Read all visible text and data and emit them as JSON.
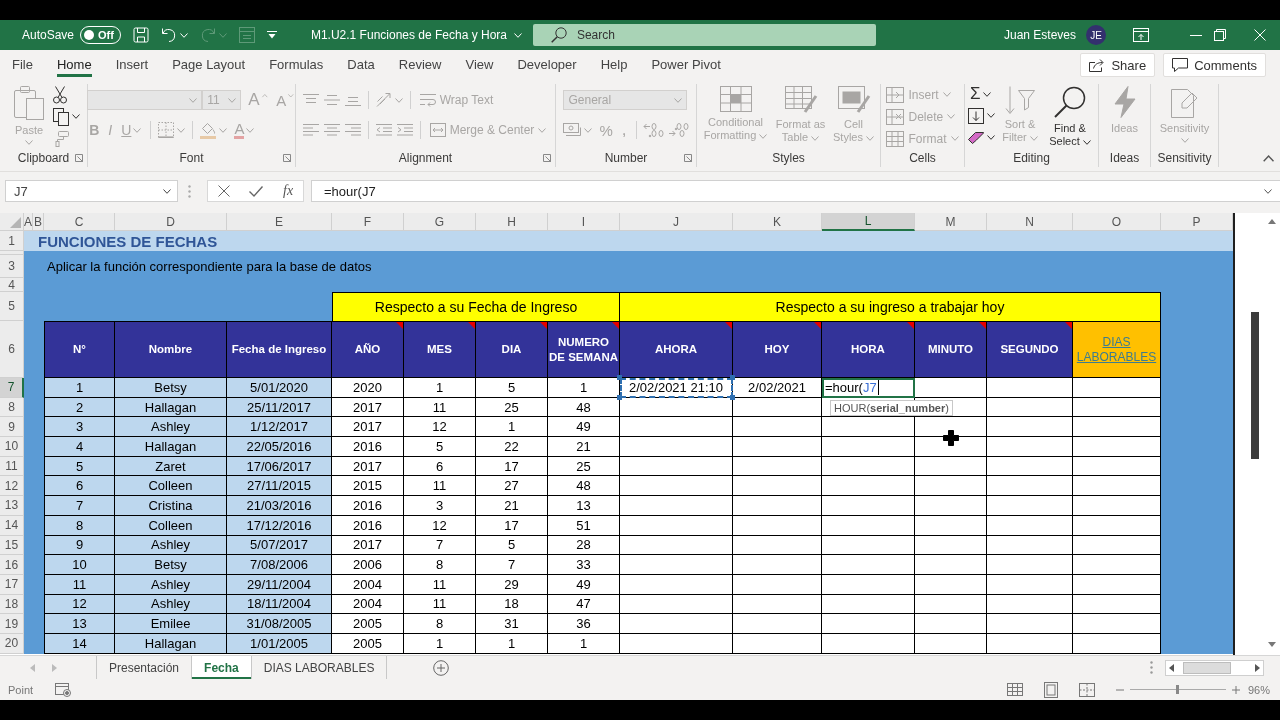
{
  "title_bar": {
    "autosave": {
      "label": "AutoSave",
      "on": false,
      "state_text": "Off"
    },
    "quick_access": [
      {
        "kind": "save",
        "menu": false,
        "disabled": false
      },
      {
        "kind": "undo",
        "menu": true,
        "disabled": false
      },
      {
        "kind": "redo",
        "menu": true,
        "disabled": true
      },
      {
        "kind": "form",
        "menu": false,
        "disabled": true
      },
      {
        "kind": "customize",
        "menu": false,
        "disabled": false
      }
    ],
    "document_title": "M1.U2.1 Funciones de Fecha y Hora",
    "search": {
      "placeholder": "Search"
    },
    "user": {
      "name": "Juan Esteves",
      "initials": "JE"
    }
  },
  "ribbon_tabs": [
    {
      "label": "File",
      "selected": false
    },
    {
      "label": "Home",
      "selected": true
    },
    {
      "label": "Insert",
      "selected": false
    },
    {
      "label": "Page Layout",
      "selected": false
    },
    {
      "label": "Formulas",
      "selected": false
    },
    {
      "label": "Data",
      "selected": false
    },
    {
      "label": "Review",
      "selected": false
    },
    {
      "label": "View",
      "selected": false
    },
    {
      "label": "Developer",
      "selected": false
    },
    {
      "label": "Help",
      "selected": false
    },
    {
      "label": "Power Pivot",
      "selected": false
    }
  ],
  "ribbon_actions": [
    {
      "kind": "share",
      "label": "Share"
    },
    {
      "kind": "comments",
      "label": "Comments"
    }
  ],
  "ribbon": {
    "groups": [
      {
        "label": "Clipboard",
        "launcher": true,
        "sections": [
          {
            "kind": "big",
            "button": {
              "kind": "paste",
              "label": "Paste",
              "menu": true,
              "disabled": true
            }
          },
          {
            "kind": "stack",
            "items": [
              {
                "kind": "cut",
                "menu": false,
                "disabled": false
              },
              {
                "kind": "copy",
                "menu": true,
                "disabled": false
              },
              {
                "kind": "format-painter",
                "menu": false,
                "disabled": true
              }
            ]
          }
        ]
      },
      {
        "label": "Font",
        "launcher": true,
        "sections": [
          {
            "kind": "rows",
            "rows": [
              [
                {
                  "kind": "font-name",
                  "menu": true,
                  "disabled": true
                },
                {
                  "kind": "font-size",
                  "value": "11",
                  "menu": true,
                  "disabled": true
                },
                {
                  "kind": "grow-font",
                  "glyph": "A",
                  "menu": false,
                  "disabled": true
                },
                {
                  "kind": "shrink-font",
                  "glyph": "A",
                  "menu": false,
                  "disabled": true
                }
              ],
              [
                {
                  "kind": "bold",
                  "glyph": "B",
                  "menu": false,
                  "disabled": true
                },
                {
                  "kind": "italic",
                  "glyph": "I",
                  "menu": false,
                  "disabled": true
                },
                {
                  "kind": "underline",
                  "glyph": "U",
                  "menu": true,
                  "disabled": true
                },
                {
                  "kind": "separator"
                },
                {
                  "kind": "borders",
                  "menu": true,
                  "disabled": true
                },
                {
                  "kind": "separator"
                },
                {
                  "kind": "fill-color",
                  "menu": true,
                  "disabled": true
                },
                {
                  "kind": "font-color",
                  "glyph": "A",
                  "menu": true,
                  "disabled": true
                }
              ]
            ]
          }
        ]
      },
      {
        "label": "Alignment",
        "launcher": true,
        "sections": [
          {
            "kind": "rows",
            "rows": [
              [
                {
                  "kind": "align-top",
                  "menu": false,
                  "disabled": true
                },
                {
                  "kind": "align-middle",
                  "menu": false,
                  "disabled": true
                },
                {
                  "kind": "align-bottom",
                  "menu": false,
                  "disabled": true
                },
                {
                  "kind": "separator"
                },
                {
                  "kind": "orientation",
                  "menu": true,
                  "disabled": true
                },
                {
                  "kind": "separator"
                },
                {
                  "kind": "wrap-text",
                  "label": "Wrap Text",
                  "menu": false,
                  "disabled": true
                }
              ],
              [
                {
                  "kind": "align-left",
                  "menu": false,
                  "disabled": true
                },
                {
                  "kind": "align-center",
                  "menu": false,
                  "disabled": true
                },
                {
                  "kind": "align-right",
                  "menu": false,
                  "disabled": true
                },
                {
                  "kind": "separator"
                },
                {
                  "kind": "decrease-indent",
                  "menu": false,
                  "disabled": true
                },
                {
                  "kind": "increase-indent",
                  "menu": false,
                  "disabled": true
                },
                {
                  "kind": "separator"
                },
                {
                  "kind": "merge",
                  "label": "Merge & Center",
                  "menu": true,
                  "disabled": true
                }
              ]
            ]
          }
        ]
      },
      {
        "label": "Number",
        "launcher": true,
        "sections": [
          {
            "kind": "rows",
            "rows": [
              [
                {
                  "kind": "number-format",
                  "value": "General",
                  "menu": true,
                  "disabled": true
                }
              ],
              [
                {
                  "kind": "accounting",
                  "menu": true,
                  "disabled": true
                },
                {
                  "kind": "percent",
                  "glyph": "%",
                  "menu": false,
                  "disabled": true
                },
                {
                  "kind": "comma",
                  "glyph": ",",
                  "menu": false,
                  "disabled": true
                },
                {
                  "kind": "separator"
                },
                {
                  "kind": "increase-decimal",
                  "menu": false,
                  "disabled": true
                },
                {
                  "kind": "decrease-decimal",
                  "menu": false,
                  "disabled": true
                }
              ]
            ]
          }
        ]
      },
      {
        "label": "Styles",
        "launcher": false,
        "sections": [
          {
            "kind": "big",
            "button": {
              "kind": "conditional-formatting",
              "label": "Conditional Formatting",
              "menu": true,
              "disabled": true
            }
          },
          {
            "kind": "big",
            "button": {
              "kind": "format-as-table",
              "label": "Format as Table",
              "menu": true,
              "disabled": true
            }
          },
          {
            "kind": "big",
            "button": {
              "kind": "cell-styles",
              "label": "Cell Styles",
              "menu": true,
              "disabled": true
            }
          }
        ]
      },
      {
        "label": "Cells",
        "launcher": false,
        "sections": [
          {
            "kind": "stack",
            "items": [
              {
                "kind": "insert",
                "label": "Insert",
                "menu": true,
                "disabled": true
              },
              {
                "kind": "delete",
                "label": "Delete",
                "menu": true,
                "disabled": true
              },
              {
                "kind": "format",
                "label": "Format",
                "menu": true,
                "disabled": true
              }
            ]
          }
        ]
      },
      {
        "label": "Editing",
        "launcher": false,
        "sections": [
          {
            "kind": "stack",
            "items": [
              {
                "kind": "autosum",
                "glyph": "Σ",
                "menu": true,
                "disabled": false
              },
              {
                "kind": "fill",
                "menu": true,
                "disabled": false
              },
              {
                "kind": "clear",
                "menu": true,
                "disabled": false
              }
            ]
          },
          {
            "kind": "big",
            "button": {
              "kind": "sort-filter",
              "label": "Sort & Filter",
              "menu": true,
              "disabled": true
            }
          },
          {
            "kind": "big",
            "button": {
              "kind": "find-select",
              "label": "Find & Select",
              "menu": true,
              "disabled": false
            }
          }
        ]
      },
      {
        "label": "Ideas",
        "launcher": false,
        "sections": [
          {
            "kind": "big",
            "button": {
              "kind": "ideas",
              "label": "Ideas",
              "menu": false,
              "disabled": true
            }
          }
        ]
      },
      {
        "label": "Sensitivity",
        "launcher": false,
        "sections": [
          {
            "kind": "big",
            "button": {
              "kind": "sensitivity",
              "label": "Sensitivity",
              "menu": true,
              "disabled": true
            }
          }
        ]
      }
    ]
  },
  "formula_bar": {
    "name_box": "J7",
    "function_glyph": "fx",
    "formula": "=hour(J7"
  },
  "sheet": {
    "column_headers": [
      {
        "label": "A",
        "selected": false
      },
      {
        "label": "B",
        "selected": false
      },
      {
        "label": "C",
        "selected": false
      },
      {
        "label": "D",
        "selected": false
      },
      {
        "label": "E",
        "selected": false
      },
      {
        "label": "F",
        "selected": false
      },
      {
        "label": "G",
        "selected": false
      },
      {
        "label": "H",
        "selected": false
      },
      {
        "label": "I",
        "selected": false
      },
      {
        "label": "J",
        "selected": false
      },
      {
        "label": "K",
        "selected": false
      },
      {
        "label": "L",
        "selected": true
      },
      {
        "label": "M",
        "selected": false
      },
      {
        "label": "N",
        "selected": false
      },
      {
        "label": "O",
        "selected": false
      },
      {
        "label": "P",
        "selected": false
      }
    ],
    "row_headers": [
      {
        "label": "1",
        "selected": false
      },
      {
        "selected": false
      },
      {
        "label": "3",
        "selected": false
      },
      {
        "label": "4",
        "selected": false
      },
      {
        "label": "5",
        "selected": false
      },
      {
        "label": "6",
        "selected": false
      }
    ],
    "title": "FUNCIONES DE FECHAS",
    "instruction": "Aplicar la función correspondiente para la base de datos",
    "table": {
      "column_groups": [
        {
          "columns": [
            {
              "label": "N°",
              "kind": "header",
              "shaded": true,
              "comment": false
            },
            {
              "label": "Nombre",
              "kind": "header",
              "shaded": true,
              "comment": false
            },
            {
              "label": "Fecha de Ingreso",
              "kind": "header",
              "shaded": true,
              "comment": false
            }
          ]
        },
        {
          "label": "Respecto a su Fecha de Ingreso",
          "columns": [
            {
              "label": "AÑO",
              "kind": "header",
              "shaded": false,
              "comment": true
            },
            {
              "label": "MES",
              "kind": "header",
              "shaded": false,
              "comment": true
            },
            {
              "label": "DIA",
              "kind": "header",
              "shaded": false,
              "comment": true
            },
            {
              "label": "NUMERO DE SEMANA",
              "kind": "header",
              "shaded": false,
              "comment": true
            }
          ]
        },
        {
          "label": "Respecto a su ingreso a trabajar hoy",
          "columns": [
            {
              "label": "AHORA",
              "kind": "header",
              "shaded": false,
              "comment": true
            },
            {
              "label": "HOY",
              "kind": "header",
              "shaded": false,
              "comment": true
            },
            {
              "label": "HORA",
              "kind": "header",
              "shaded": false,
              "comment": true
            },
            {
              "label": "MINUTO",
              "kind": "header",
              "shaded": false,
              "comment": true
            },
            {
              "label": "SEGUNDO",
              "kind": "header",
              "shaded": false,
              "comment": true
            },
            {
              "label": "DIAS LABORABLES",
              "kind": "link",
              "shaded": false,
              "comment": false
            }
          ]
        }
      ],
      "rows": [
        {
          "header": {
            "label": "7",
            "selected": true
          },
          "cells": [
            "1",
            "Betsy",
            "5/01/2020",
            "2020",
            "1",
            "5",
            "1",
            {
              "kind": "referenced",
              "value": "2/02/2021 21:10"
            },
            "2/02/2021",
            {
              "kind": "editing",
              "value": "=hour(",
              "reference": "J7",
              "tooltip": "HOUR(**serial_number**)"
            }
          ]
        },
        {
          "header": {
            "label": "8",
            "selected": false
          },
          "cells": [
            "2",
            "Hallagan",
            "25/11/2017",
            "2017",
            "11",
            "25",
            "48"
          ]
        },
        {
          "header": {
            "label": "9",
            "selected": false
          },
          "cells": [
            "3",
            "Ashley",
            "1/12/2017",
            "2017",
            "12",
            "1",
            "49"
          ]
        },
        {
          "header": {
            "label": "10",
            "selected": false
          },
          "cells": [
            "4",
            "Hallagan",
            "22/05/2016",
            "2016",
            "5",
            "22",
            "21"
          ]
        },
        {
          "header": {
            "label": "11",
            "selected": false
          },
          "cells": [
            "5",
            "Zaret",
            "17/06/2017",
            "2017",
            "6",
            "17",
            "25"
          ]
        },
        {
          "header": {
            "label": "12",
            "selected": false
          },
          "cells": [
            "6",
            "Colleen",
            "27/11/2015",
            "2015",
            "11",
            "27",
            "48"
          ]
        },
        {
          "header": {
            "label": "13",
            "selected": false
          },
          "cells": [
            "7",
            "Cristina",
            "21/03/2016",
            "2016",
            "3",
            "21",
            "13"
          ]
        },
        {
          "header": {
            "label": "14",
            "selected": false
          },
          "cells": [
            "8",
            "Colleen",
            "17/12/2016",
            "2016",
            "12",
            "17",
            "51"
          ]
        },
        {
          "header": {
            "label": "15",
            "selected": false
          },
          "cells": [
            "9",
            "Ashley",
            "5/07/2017",
            "2017",
            "7",
            "5",
            "28"
          ]
        },
        {
          "header": {
            "label": "16",
            "selected": false
          },
          "cells": [
            "10",
            "Betsy",
            "7/08/2006",
            "2006",
            "8",
            "7",
            "33"
          ]
        },
        {
          "header": {
            "label": "17",
            "selected": false
          },
          "cells": [
            "11",
            "Ashley",
            "29/11/2004",
            "2004",
            "11",
            "29",
            "49"
          ]
        },
        {
          "header": {
            "label": "18",
            "selected": false
          },
          "cells": [
            "12",
            "Ashley",
            "18/11/2004",
            "2004",
            "11",
            "18",
            "47"
          ]
        },
        {
          "header": {
            "label": "19",
            "selected": false
          },
          "cells": [
            "13",
            "Emilee",
            "31/08/2005",
            "2005",
            "8",
            "31",
            "36"
          ]
        },
        {
          "header": {
            "label": "20",
            "selected": false
          },
          "cells": [
            "14",
            "Hallagan",
            "1/01/2005",
            "2005",
            "1",
            "1",
            "1"
          ]
        }
      ]
    }
  },
  "sheet_tabs": [
    {
      "label": "Presentación",
      "selected": false
    },
    {
      "label": "Fecha",
      "selected": true
    },
    {
      "label": "DIAS LABORABLES",
      "selected": false
    }
  ],
  "status_bar": {
    "mode": "Point",
    "zoom": {
      "level": 0.49,
      "label": "96%"
    }
  }
}
